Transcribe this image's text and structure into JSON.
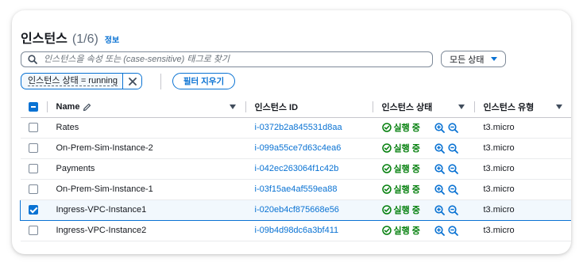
{
  "header": {
    "title": "인스턴스",
    "count": "(1/6)",
    "info_link": "정보"
  },
  "search": {
    "placeholder": "인스턴스을 속성 또는 (case-sensitive) 태그로 찾기",
    "icon": "search-icon"
  },
  "status_filter": {
    "label": "모든 상태"
  },
  "filter_token": {
    "label": "인스턴스 상태 = running"
  },
  "clear_filters_label": "필터 지우기",
  "table": {
    "columns": {
      "name": "Name",
      "instance_id": "인스턴스 ID",
      "state": "인스턴스 상태",
      "type": "인스턴스 유형"
    },
    "rows": [
      {
        "name": "Rates",
        "instance_id": "i-0372b2a845531d8aa",
        "state": "실행 중",
        "type": "t3.micro",
        "selected": false
      },
      {
        "name": "On-Prem-Sim-Instance-2",
        "instance_id": "i-099a55ce7d63c4ea6",
        "state": "실행 중",
        "type": "t3.micro",
        "selected": false
      },
      {
        "name": "Payments",
        "instance_id": "i-042ec263064f1c42b",
        "state": "실행 중",
        "type": "t3.micro",
        "selected": false
      },
      {
        "name": "On-Prem-Sim-Instance-1",
        "instance_id": "i-03f15ae4af559ea88",
        "state": "실행 중",
        "type": "t3.micro",
        "selected": false
      },
      {
        "name": "Ingress-VPC-Instance1",
        "instance_id": "i-020eb4cf875668e56",
        "state": "실행 중",
        "type": "t3.micro",
        "selected": true
      },
      {
        "name": "Ingress-VPC-Instance2",
        "instance_id": "i-09b4d98dc6a3bf411",
        "state": "실행 중",
        "type": "t3.micro",
        "selected": false
      }
    ]
  },
  "colors": {
    "link_blue": "#0972d3",
    "running_green": "#037f0c",
    "selected_row_bg": "#f2f8fd"
  }
}
